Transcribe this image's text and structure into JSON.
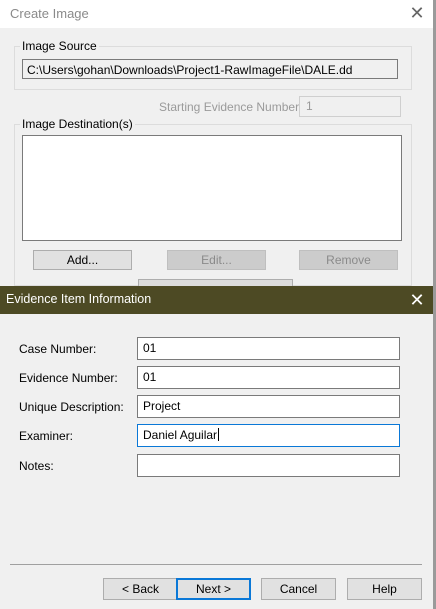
{
  "create_image": {
    "title": "Create Image",
    "close_glyph": "✕",
    "image_source": {
      "label": "Image Source",
      "path": "C:\\Users\\gohan\\Downloads\\Project1-RawImageFile\\DALE.dd"
    },
    "starting_evidence_number": {
      "label": "Starting Evidence Number:",
      "value": "1"
    },
    "image_destinations": {
      "label": "Image Destination(s)",
      "items": []
    },
    "buttons": {
      "add": "Add...",
      "edit": "Edit...",
      "remove": "Remove"
    }
  },
  "evidence_dialog": {
    "title": "Evidence Item Information",
    "close_glyph": "✕",
    "fields": {
      "case_number": {
        "label": "Case Number:",
        "value": "01"
      },
      "evidence_number": {
        "label": "Evidence Number:",
        "value": "01"
      },
      "unique_description": {
        "label": "Unique Description:",
        "value": "Project"
      },
      "examiner": {
        "label": "Examiner:",
        "value": "Daniel Aguilar"
      },
      "notes": {
        "label": "Notes:",
        "value": ""
      }
    },
    "buttons": {
      "back": "< Back",
      "next": "Next >",
      "cancel": "Cancel",
      "help": "Help"
    }
  },
  "colors": {
    "dialog_titlebar": "#4d4a24",
    "focus_accent": "#0a78d7"
  }
}
